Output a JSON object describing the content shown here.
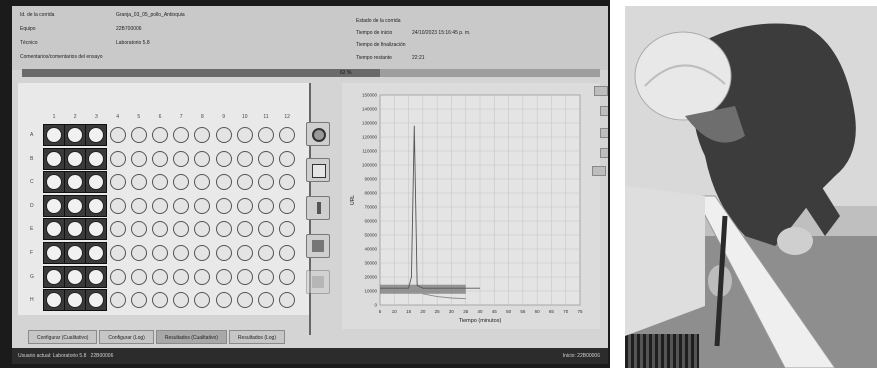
{
  "info": {
    "left": [
      {
        "label": "Id. de la corrida",
        "value": "Granja_03_05_pollo_Antioquia"
      },
      {
        "label": "Equipo",
        "value": "22B700006"
      },
      {
        "label": "Técnico",
        "value": "Laboratorio 5.8"
      },
      {
        "label": "Comentarios/comentarios del ensayo",
        "value": ""
      }
    ],
    "right": [
      {
        "label": "Estado de la corrida",
        "value": ""
      },
      {
        "label": "Tiempo de inicio",
        "value": "24/10/2023 15:16:45 p. m."
      },
      {
        "label": "Tiempo de finalización",
        "value": ""
      },
      {
        "label": "Tiempo restante",
        "value": "22:21"
      }
    ]
  },
  "progress": {
    "label": "62 %",
    "fraction": 0.62
  },
  "plate": {
    "columns": [
      "1",
      "2",
      "3",
      "4",
      "5",
      "6",
      "7",
      "8",
      "9",
      "10",
      "11",
      "12"
    ],
    "rows": [
      "A",
      "B",
      "C",
      "D",
      "E",
      "F",
      "G",
      "H"
    ],
    "filled_columns": 3
  },
  "chart_data": {
    "type": "line",
    "ylabel": "URL",
    "xlabel": "Tiempo (minutos)",
    "yticks": [
      "0",
      "10000",
      "20000",
      "30000",
      "40000",
      "50000",
      "60000",
      "70000",
      "80000",
      "90000",
      "100000",
      "110000",
      "120000",
      "130000",
      "140000",
      "150000"
    ],
    "xticks": [
      "5",
      "10",
      "15",
      "20",
      "25",
      "30",
      "35",
      "40",
      "45",
      "50",
      "55",
      "60",
      "65",
      "70",
      "75"
    ],
    "ylim": [
      0,
      150000
    ],
    "xlim": [
      5,
      75
    ],
    "series": [
      {
        "values_x": [
          5,
          15,
          16,
          17,
          18,
          20,
          25,
          30,
          35,
          40
        ],
        "values_y": [
          12000,
          12000,
          20000,
          128000,
          14000,
          12000,
          12000,
          12000,
          12000,
          12000
        ]
      },
      {
        "values_x": [
          20,
          25,
          30,
          35
        ],
        "values_y": [
          8000,
          6000,
          5000,
          4500
        ]
      }
    ]
  },
  "tabs": [
    "Configurar (Cualitativo)",
    "Configurar (Log)",
    "Resultados (Cualitativo)",
    "Resultados (Log)"
  ],
  "active_tab": 2,
  "status": {
    "left": "Usuario actual: Laboratorio 5.8",
    "id": "22B00006",
    "right": "Inicio: 22B00006"
  },
  "colors": {
    "accent": "#6a6a6a",
    "screen_bg": "#d4d4d4"
  }
}
